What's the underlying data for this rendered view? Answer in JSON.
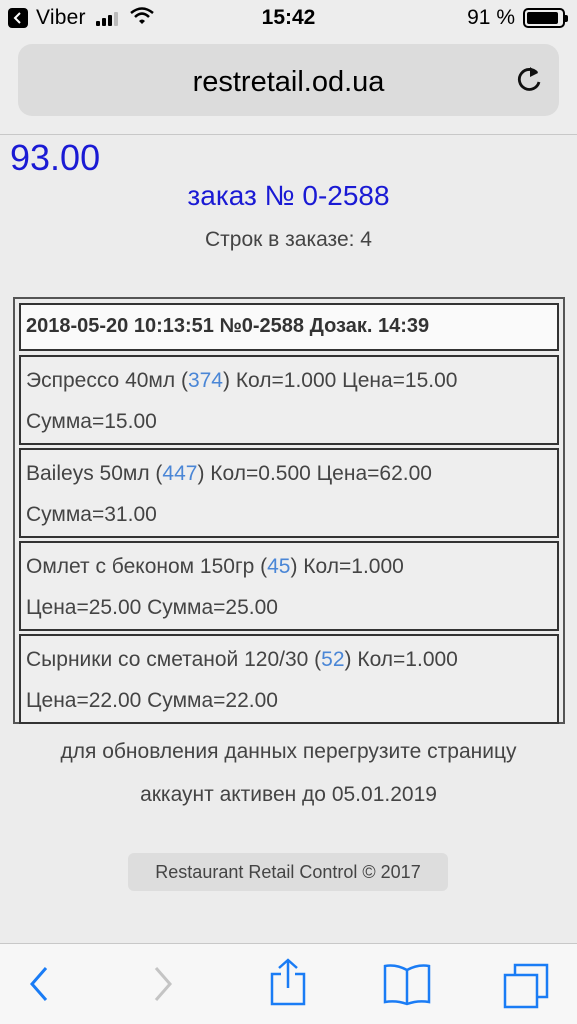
{
  "status_bar": {
    "carrier": "Viber",
    "time": "15:42",
    "battery_percent": "91 %",
    "battery_level": 0.91
  },
  "browser": {
    "url": "restretail.od.ua"
  },
  "page": {
    "total": "93.00",
    "order_title": "заказ № 0-2588",
    "rows_count": "Строк в заказе: 4",
    "order_header": "2018-05-20 10:13:51 №0-2588 Дозак. 14:39",
    "items": [
      {
        "name": "Эспрессо 40мл (",
        "code": "374",
        "line1_rest": ") Кол=1.000 Цена=15.00",
        "line2": "Сумма=15.00"
      },
      {
        "name": "Baileys 50мл (",
        "code": "447",
        "line1_rest": ") Кол=0.500 Цена=62.00",
        "line2": "Сумма=31.00"
      },
      {
        "name": "Омлет с беконом 150гр (",
        "code": "45",
        "line1_rest": ") Кол=1.000",
        "line2": "Цена=25.00 Сумма=25.00"
      },
      {
        "name": "Сырники со сметаной 120/30 (",
        "code": "52",
        "line1_rest": ") Кол=1.000",
        "line2": "Цена=22.00 Сумма=22.00"
      }
    ],
    "refresh_hint": "для обновления данных перегрузите страницу",
    "account_active": "аккаунт активен до 05.01.2019",
    "footer": "Restaurant Retail Control © 2017"
  },
  "colors": {
    "accent_blue": "#1a1ad4",
    "link_blue": "#4a86d6",
    "ios_blue": "#1a7cf5"
  },
  "toolbar_icons": [
    "back-icon",
    "forward-icon",
    "share-icon",
    "bookmarks-icon",
    "tabs-icon"
  ]
}
